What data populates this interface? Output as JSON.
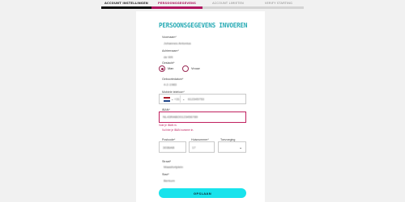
{
  "steps": [
    {
      "label": "Account instellingen"
    },
    {
      "label": "Persoonsgegevens"
    },
    {
      "label": "Account Limieten"
    },
    {
      "label": "Verify Starting"
    }
  ],
  "form": {
    "title": "PERSOONSGEGEVENS INVOEREN",
    "voornaam": {
      "label": "Voornaam*",
      "value": "Johannes Antonius"
    },
    "achternaam": {
      "label": "Achternaam*",
      "value": "de Wit"
    },
    "geslacht": {
      "label": "Geslacht*",
      "options": [
        "Man",
        "Vrouw"
      ],
      "selected": "Man"
    },
    "geboortedatum": {
      "label": "Geboortedatum*",
      "value": "4-2-1983"
    },
    "mobiel": {
      "label": "Mobiele telefoon*",
      "country_code": "+31",
      "value": "612345753"
    },
    "iban": {
      "label": "IBAN*",
      "value": "NL43RABO0123456789",
      "error_1": "Voer je IBAN in.",
      "error_2": "Vul hier je IBAN nummer in."
    },
    "postcode": {
      "label": "Postcode*",
      "value": "3036AB"
    },
    "huisnummer": {
      "label": "Huisnummer*",
      "value": "17"
    },
    "toevoeging": {
      "label": "Toevoeging",
      "value": ""
    },
    "straat": {
      "label": "Straat*",
      "value": "Maasfortplein"
    },
    "stad": {
      "label": "Stad*",
      "value": "Berkum"
    },
    "submit_label": "Opslaan"
  },
  "colors": {
    "accent": "#b01660",
    "title": "#27aab4",
    "button": "#19e3ec",
    "error": "#c0205f"
  }
}
